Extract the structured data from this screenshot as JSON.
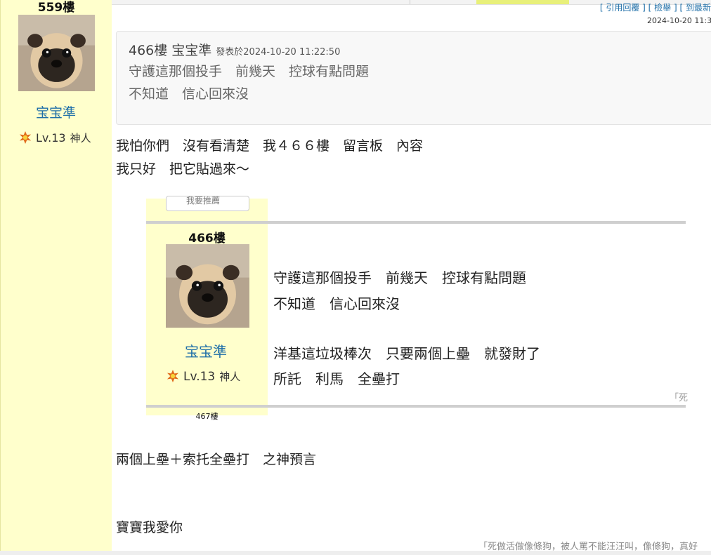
{
  "post": {
    "floor": "559樓",
    "username": "宝宝準",
    "level": "Lv.13",
    "title": "神人",
    "actions": "[ 引用回覆 ] [ 檢舉 ] [ 到最新",
    "timestamp": "2024-10-20 11:3"
  },
  "quote": {
    "floor": "466樓",
    "username": "宝宝準",
    "posted_label": "發表於2024-10-20 11:22:50",
    "lines": [
      "守護這那個投手　前幾天　控球有點問題",
      "不知道　信心回來沒"
    ]
  },
  "body": {
    "line1": "我怕你們　沒有看清楚　我４６６樓　留言板　內容",
    "line2": "我只好　把它貼過來～",
    "line3": "兩個上壘＋索托全壘打　之神預言",
    "line4": "寶寶我愛你"
  },
  "embed": {
    "button_text": "我要推薦",
    "floor": "466樓",
    "username": "宝宝準",
    "level": "Lv.13",
    "title": "神人",
    "lines": [
      "守護這那個投手　前幾天　控球有點問題",
      "不知道　信心回來沒",
      "洋基這垃圾棒次　只要兩個上壘　就發財了",
      "所託　利馬　全壘打"
    ],
    "sig_fragment": "「死",
    "next_floor": "467樓"
  },
  "signature": "「死做活做像條狗，被人罵不能汪汪叫，像條狗，真好",
  "colors": {
    "sidebar": "#ffffcc",
    "link": "#1f6fa8",
    "gem": "#e06a1a"
  }
}
